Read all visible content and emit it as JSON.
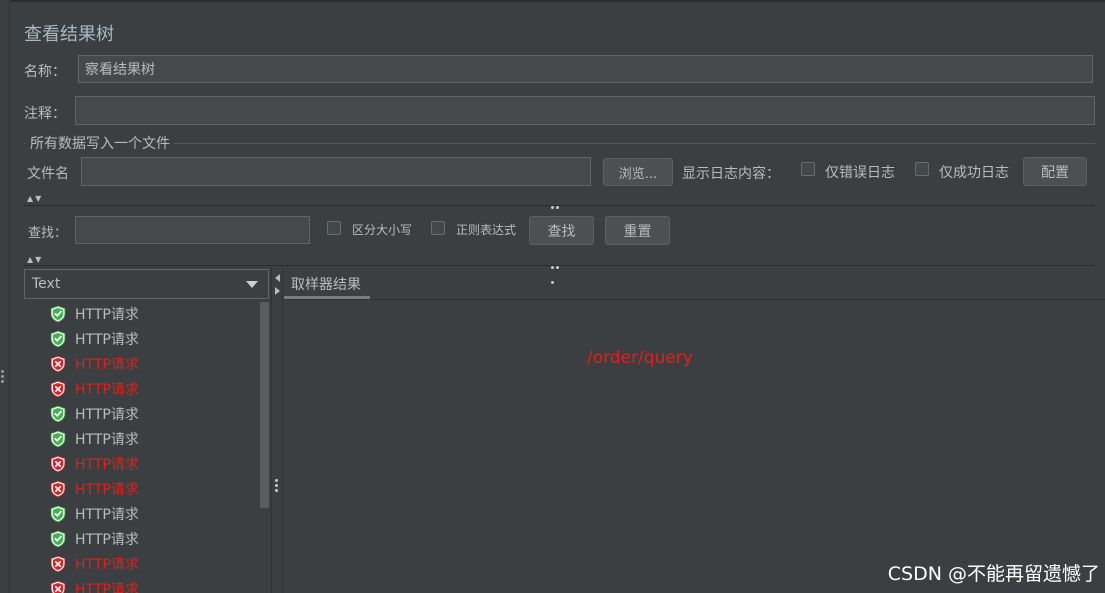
{
  "title": "查看结果树",
  "name_label": "名称：",
  "name_value": "察看结果树",
  "comment_label": "注释：",
  "comment_value": "",
  "file_group_title": "所有数据写入一个文件",
  "filename_label": "文件名",
  "filename_value": "",
  "browse_button": "浏览...",
  "log_content_label": "显示日志内容：",
  "errors_only_label": "仅错误日志",
  "success_only_label": "仅成功日志",
  "configure_button": "配置",
  "search_label": "查找：",
  "search_value": "",
  "case_sensitive_label": "区分大小写",
  "regex_label": "正则表达式",
  "find_button": "查找",
  "reset_button": "重置",
  "renderer_select": "Text",
  "tab_sampler_result": "取样器结果",
  "result_text": "/order/query",
  "watermark": "CSDN @不能再留遗憾了",
  "tree_items": [
    {
      "label": "HTTP请求",
      "status": "success"
    },
    {
      "label": "HTTP请求",
      "status": "success"
    },
    {
      "label": "HTTP请求",
      "status": "error"
    },
    {
      "label": "HTTP请求",
      "status": "error"
    },
    {
      "label": "HTTP请求",
      "status": "success"
    },
    {
      "label": "HTTP请求",
      "status": "success"
    },
    {
      "label": "HTTP请求",
      "status": "error"
    },
    {
      "label": "HTTP请求",
      "status": "error"
    },
    {
      "label": "HTTP请求",
      "status": "success"
    },
    {
      "label": "HTTP请求",
      "status": "success"
    },
    {
      "label": "HTTP请求",
      "status": "error"
    },
    {
      "label": "HTTP请求",
      "status": "error"
    }
  ],
  "colors": {
    "background": "#3c3f41",
    "error_text": "#e0201b",
    "success_icon": "#3fb34f",
    "error_icon": "#d1242b"
  },
  "icons": {
    "success": "green-shield-check-icon",
    "error": "red-shield-x-icon"
  }
}
